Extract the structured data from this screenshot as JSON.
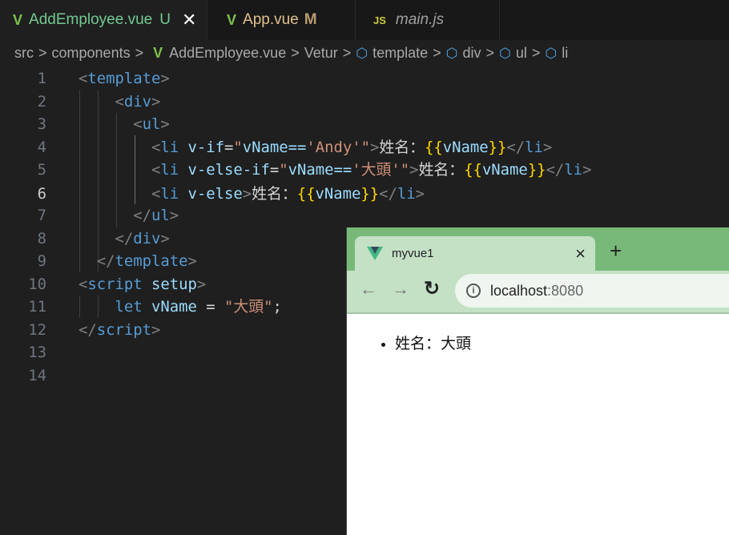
{
  "tabs": [
    {
      "label": "AddEmployee.vue",
      "badge": "U",
      "icon": "vue-icon",
      "color": "#73c991"
    },
    {
      "label": "App.vue",
      "badge": "M",
      "icon": "vue-icon",
      "color": "#e2c08d"
    },
    {
      "label": "main.js",
      "icon": "js-icon",
      "icon_text": "JS"
    }
  ],
  "breadcrumb": [
    "src",
    "components",
    "AddEmployee.vue",
    "Vetur",
    "template",
    "div",
    "ul",
    "li"
  ],
  "sep": ">",
  "vue_glyph": "V",
  "code": {
    "current_line": 6,
    "lines": [
      [
        [
          "<",
          "p"
        ],
        [
          "template",
          "t"
        ],
        [
          ">",
          "p"
        ]
      ],
      [
        [
          "    ",
          "w"
        ],
        [
          "<",
          "p"
        ],
        [
          "div",
          "t"
        ],
        [
          ">",
          "p"
        ]
      ],
      [
        [
          "      ",
          "w"
        ],
        [
          "<",
          "p"
        ],
        [
          "ul",
          "t"
        ],
        [
          ">",
          "p"
        ]
      ],
      [
        [
          "        ",
          "w"
        ],
        [
          "<",
          "p"
        ],
        [
          "li",
          "t"
        ],
        [
          " ",
          "w"
        ],
        [
          "v-if",
          "a"
        ],
        [
          "=",
          "w"
        ],
        [
          "\"",
          "s"
        ],
        [
          "vName==",
          "a"
        ],
        [
          "'Andy'",
          "s"
        ],
        [
          "\"",
          "s"
        ],
        [
          ">",
          "p"
        ],
        [
          "姓名：",
          "w"
        ],
        [
          "{{",
          "m"
        ],
        [
          "vName",
          "a"
        ],
        [
          "}}",
          "m"
        ],
        [
          "</",
          "p"
        ],
        [
          "li",
          "t"
        ],
        [
          ">",
          "p"
        ]
      ],
      [
        [
          "        ",
          "w"
        ],
        [
          "<",
          "p"
        ],
        [
          "li",
          "t"
        ],
        [
          " ",
          "w"
        ],
        [
          "v-else-if",
          "a"
        ],
        [
          "=",
          "w"
        ],
        [
          "\"",
          "s"
        ],
        [
          "vName==",
          "a"
        ],
        [
          "'大頭'",
          "s"
        ],
        [
          "\"",
          "s"
        ],
        [
          ">",
          "p"
        ],
        [
          "姓名：",
          "w"
        ],
        [
          "{{",
          "m"
        ],
        [
          "vName",
          "a"
        ],
        [
          "}}",
          "m"
        ],
        [
          "</",
          "p"
        ],
        [
          "li",
          "t"
        ],
        [
          ">",
          "p"
        ]
      ],
      [
        [
          "        ",
          "w"
        ],
        [
          "<",
          "p"
        ],
        [
          "li",
          "t"
        ],
        [
          " ",
          "w"
        ],
        [
          "v-else",
          "a"
        ],
        [
          ">",
          "p"
        ],
        [
          "姓名：",
          "w"
        ],
        [
          "{{",
          "m"
        ],
        [
          "vName",
          "a"
        ],
        [
          "}}",
          "m"
        ],
        [
          "</",
          "p"
        ],
        [
          "li",
          "t"
        ],
        [
          ">",
          "p"
        ]
      ],
      [
        [
          "      ",
          "w"
        ],
        [
          "</",
          "p"
        ],
        [
          "ul",
          "t"
        ],
        [
          ">",
          "p"
        ]
      ],
      [
        [
          "    ",
          "w"
        ],
        [
          "</",
          "p"
        ],
        [
          "div",
          "t"
        ],
        [
          ">",
          "p"
        ]
      ],
      [
        [
          "  ",
          "w"
        ],
        [
          "</",
          "p"
        ],
        [
          "template",
          "t"
        ],
        [
          ">",
          "p"
        ]
      ],
      [
        [
          "<",
          "p"
        ],
        [
          "script",
          "t"
        ],
        [
          " ",
          "w"
        ],
        [
          "setup",
          "a"
        ],
        [
          ">",
          "p"
        ]
      ],
      [
        [
          "    ",
          "w"
        ],
        [
          "let",
          "k"
        ],
        [
          " ",
          "w"
        ],
        [
          "vName",
          "a"
        ],
        [
          " = ",
          "w"
        ],
        [
          "\"大頭\"",
          "s"
        ],
        [
          ";",
          "w"
        ]
      ],
      [
        [
          "</",
          "p"
        ],
        [
          "script",
          "t"
        ],
        [
          ">",
          "p"
        ]
      ],
      [],
      []
    ]
  },
  "browser": {
    "tab_title": "myvue1",
    "close": "×",
    "new_tab": "+",
    "url_host": "localhost",
    "url_port": ":8080",
    "content": [
      "姓名：大頭"
    ]
  }
}
